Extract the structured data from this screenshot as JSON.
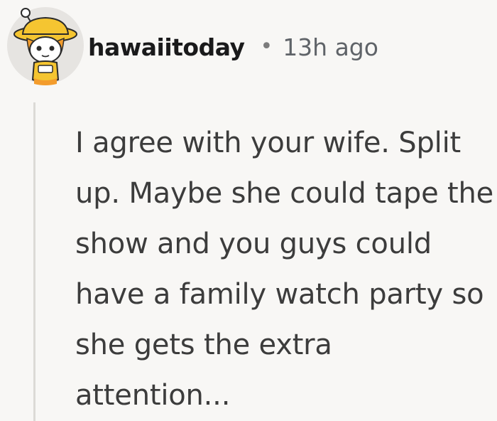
{
  "comment": {
    "author": "hawaiitoday",
    "separator": "•",
    "timestamp": "13h ago",
    "avatar_icon": "snoo-avatar-yellow-bucket-hat",
    "body": "I agree with your wife. Split up. Maybe she could tape the show and you guys could have a family watch party so she gets the extra attention..."
  },
  "colors": {
    "background": "#f8f7f5",
    "author_text": "#1a1a1b",
    "meta_text": "#5f6368",
    "body_text": "#3c3c3c",
    "thread_line": "#dcdad6"
  }
}
